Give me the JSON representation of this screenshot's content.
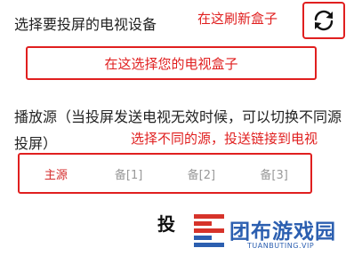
{
  "header": {
    "title": "选择要投屏的电视设备",
    "refresh_note": "在这刷新盒子"
  },
  "device_select": {
    "placeholder": "在这选择您的电视盒子"
  },
  "source": {
    "description": "播放源（当投屏发送电视无效时候，可以切换不同源投屏）",
    "note": "选择不同的源，投送链接到电视",
    "tabs": [
      {
        "label": "主源",
        "active": true
      },
      {
        "label": "备[1]",
        "active": false
      },
      {
        "label": "备[2]",
        "active": false
      },
      {
        "label": "备[3]",
        "active": false
      }
    ]
  },
  "cast_button": {
    "label": "投"
  },
  "watermark": {
    "name": "团布游戏园",
    "url": "TUANBUTING.VIP"
  },
  "colors": {
    "annotation_red": "#e01f1f",
    "active_tab": "#d42b2b",
    "brand_blue": "#2c5fb0",
    "brand_red": "#d6332a"
  },
  "icons": {
    "refresh": "refresh-icon"
  }
}
